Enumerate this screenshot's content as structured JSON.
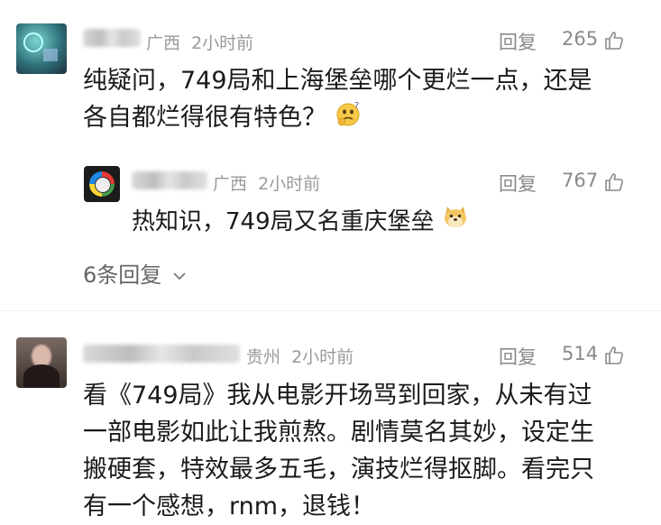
{
  "comment1": {
    "location": "广西",
    "time": "2小时前",
    "reply_label": "回复",
    "likes": "265",
    "lines": [
      "纯疑问，749局和上海堡垒哪个更烂一点，还是",
      "各自都烂得很有特色？"
    ],
    "emoji_icon": "thinking-emoji-icon"
  },
  "reply1": {
    "location": "广西",
    "time": "2小时前",
    "reply_label": "回复",
    "likes": "767",
    "text": "热知识，749局又名重庆堡垒",
    "emoji_icon": "doge-emoji-icon"
  },
  "more_replies": {
    "label": "6条回复",
    "icon": "chevron-down-icon"
  },
  "comment2": {
    "location": "贵州",
    "time": "2小时前",
    "reply_label": "回复",
    "likes": "514",
    "lines": [
      "看《749局》我从电影开场骂到回家，从未有过",
      "一部电影如此让我煎熬。剧情莫名其妙，设定生",
      "搬硬套，特效最多五毛，演技烂得抠脚。看完只",
      "有一个感想，rnm，退钱！"
    ]
  },
  "colors": {
    "text": "#1a1a1a",
    "meta": "#9a9a9a",
    "action": "#8a8a8a",
    "background": "#ffffff"
  }
}
